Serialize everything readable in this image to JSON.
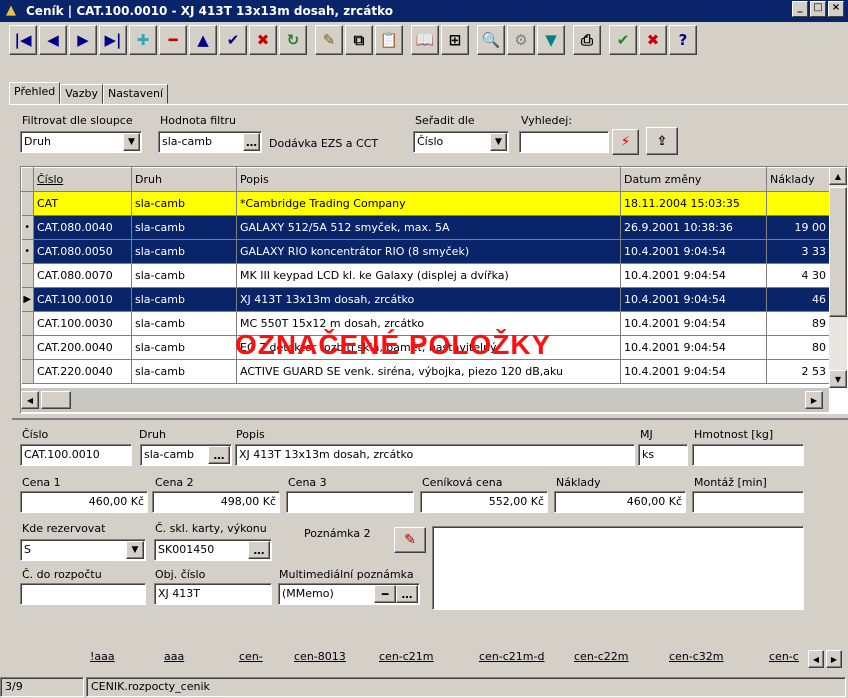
{
  "window": {
    "title": "Ceník | CAT.100.0010 - XJ 413T 13x13m dosah, zrcátko",
    "min": "_",
    "max": "□",
    "close": "×"
  },
  "toolbar": {
    "buttons": [
      {
        "name": "first-record-button",
        "glyph": "|◀",
        "color": "#00008b"
      },
      {
        "name": "prev-record-button",
        "glyph": "◀",
        "color": "#00008b"
      },
      {
        "name": "next-record-button",
        "glyph": "▶",
        "color": "#00008b"
      },
      {
        "name": "last-record-button",
        "glyph": "▶|",
        "color": "#00008b"
      },
      {
        "name": "insert-record-button",
        "glyph": "✚",
        "color": "#3aa0c0"
      },
      {
        "name": "delete-record-button",
        "glyph": "━",
        "color": "#cc0000"
      },
      {
        "name": "edit-record-button",
        "glyph": "▲",
        "color": "#00008b"
      },
      {
        "name": "post-record-button",
        "glyph": "✔",
        "color": "#00008b"
      },
      {
        "name": "cancel-record-button",
        "glyph": "✖",
        "color": "#cc0000"
      },
      {
        "name": "refresh-button",
        "glyph": "↻",
        "color": "#2e7d32"
      },
      {
        "name": "pin-button",
        "glyph": "✎",
        "color": "#806000"
      },
      {
        "name": "copy-button",
        "glyph": "⧉",
        "color": "#000"
      },
      {
        "name": "paste-button",
        "glyph": "📋",
        "color": "#000"
      },
      {
        "name": "book-button",
        "glyph": "📖",
        "color": "#000"
      },
      {
        "name": "tree-button",
        "glyph": "⊞",
        "color": "#000"
      },
      {
        "name": "search-button",
        "glyph": "🔍",
        "color": "#000"
      },
      {
        "name": "settings-button",
        "glyph": "⚙",
        "color": "#808080"
      },
      {
        "name": "filter-button",
        "glyph": "▼",
        "color": "#008080"
      },
      {
        "name": "print-button",
        "glyph": "⎙",
        "color": "#000"
      },
      {
        "name": "ok-button",
        "glyph": "✔",
        "color": "#1b8a1b"
      },
      {
        "name": "close-button",
        "glyph": "✖",
        "color": "#cc0000"
      },
      {
        "name": "help-button",
        "glyph": "?",
        "color": "#00008b"
      }
    ]
  },
  "tabs": [
    "Přehled",
    "Vazby",
    "Nastavení"
  ],
  "filter": {
    "col_label": "Filtrovat dle sloupce",
    "col_value": "Druh",
    "val_label": "Hodnota filtru",
    "val_value": "sla-camb",
    "val_desc": "Dodávka EZS a CCT",
    "sort_label": "Seřadit dle",
    "sort_value": "Číslo",
    "search_label": "Vyhledej:",
    "search_value": ""
  },
  "grid": {
    "headers": [
      "Číslo",
      "Druh",
      "Popis",
      "Datum změny",
      "Náklady"
    ],
    "rows": [
      {
        "ind": "",
        "c": "CAT",
        "d": "sla-camb",
        "p": "*Cambridge Trading Company",
        "dt": "18.11.2004 15:03:35",
        "n": "",
        "style": "yellow"
      },
      {
        "ind": "•",
        "c": "CAT.080.0040",
        "d": "sla-camb",
        "p": "GALAXY 512/5A 512 smyček, max. 5A",
        "dt": "26.9.2001 10:38:36",
        "n": "19 00",
        "style": "sel"
      },
      {
        "ind": "•",
        "c": "CAT.080.0050",
        "d": "sla-camb",
        "p": "GALAXY RIO koncentrátor RIO (8 smyček)",
        "dt": "10.4.2001 9:04:54",
        "n": "3 33",
        "style": "sel"
      },
      {
        "ind": "",
        "c": "CAT.080.0070",
        "d": "sla-camb",
        "p": "MK III keypad LCD kl. ke Galaxy (displej a dvířka)",
        "dt": "10.4.2001 9:04:54",
        "n": "4 30",
        "style": ""
      },
      {
        "ind": "▶",
        "c": "CAT.100.0010",
        "d": "sla-camb",
        "p": "XJ 413T 13x13m dosah, zrcátko",
        "dt": "10.4.2001 9:04:54",
        "n": "46",
        "style": "sel"
      },
      {
        "ind": "",
        "c": "CAT.100.0030",
        "d": "sla-camb",
        "p": "MC 550T 15x12 m dosah, zrcátko",
        "dt": "10.4.2001 9:04:54",
        "n": "89",
        "style": ""
      },
      {
        "ind": "",
        "c": "CAT.200.0040",
        "d": "sla-camb",
        "p": "EG 7 detektor rozbití skla, paměť, nastavitelný",
        "dt": "10.4.2001 9:04:54",
        "n": "80",
        "style": ""
      },
      {
        "ind": "",
        "c": "CAT.220.0040",
        "d": "sla-camb",
        "p": "ACTIVE GUARD SE venk. siréna, výbojka, piezo 120 dB,aku",
        "dt": "10.4.2001 9:04:54",
        "n": "2 53",
        "style": ""
      }
    ],
    "overlay": "OZNAČENÉ POLOŽKY"
  },
  "detail": {
    "cislo_label": "Číslo",
    "cislo": "CAT.100.0010",
    "druh_label": "Druh",
    "druh": "sla-camb",
    "popis_label": "Popis",
    "popis": "XJ 413T 13x13m dosah, zrcátko",
    "mj_label": "MJ",
    "mj": "ks",
    "hmotnost_label": "Hmotnost [kg]",
    "hmotnost": "",
    "cena1_label": "Cena 1",
    "cena1": "460,00 Kč",
    "cena2_label": "Cena 2",
    "cena2": "498,00 Kč",
    "cena3_label": "Cena 3",
    "cena3": "",
    "cenik_label": "Ceníková cena",
    "cenik": "552,00 Kč",
    "naklady_label": "Náklady",
    "naklady": "460,00 Kč",
    "montaz_label": "Montáž [min]",
    "montaz": "",
    "kde_label": "Kde rezervovat",
    "kde": "S",
    "skl_label": "Č. skl. karty, výkonu",
    "skl": "SK001450",
    "pozn2_label": "Poznámka 2",
    "pozn2": "",
    "rozpocet_label": "Č. do rozpočtu",
    "rozpocet": "",
    "obj_label": "Obj. číslo",
    "obj": "XJ 413T",
    "mm_label": "Multimediální poznámka",
    "mm": "(MMemo)"
  },
  "bottom_tabs": [
    "!aaa",
    "aaa",
    "cen-",
    "cen-8013",
    "cen-c21m",
    "cen-c21m-d",
    "cen-c22m",
    "cen-c32m",
    "cen-c"
  ],
  "status": {
    "pos": "3/9",
    "table": "CENIK.rozpocty_cenik"
  }
}
